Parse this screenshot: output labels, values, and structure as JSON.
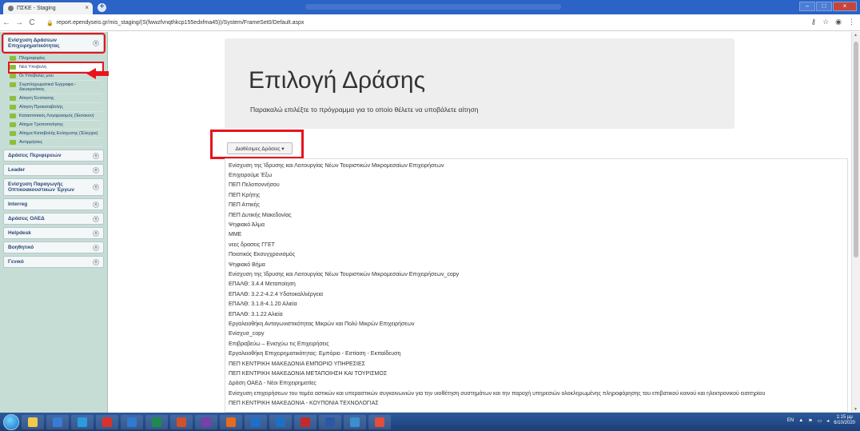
{
  "browser": {
    "tab_title": "ΠΣΚΕ - Staging",
    "tab_close": "×",
    "new_tab": "+",
    "nav": {
      "back": "←",
      "forward": "→",
      "reload": "C"
    },
    "url": "report.ependyseis.gr/mis_staging/(S(fwwzfvnqthkcp155edxfma45))/System/FrameSet0/Default.aspx",
    "window_buttons": {
      "minimize": "–",
      "maximize": "□",
      "close": "×"
    }
  },
  "sidebar": {
    "sections": [
      {
        "label": "Ενίσχυση Δράσεων Επιχειρηματικότητας",
        "expanded": true,
        "items": [
          "Πληροφορίες",
          "Νέα Υποβολή",
          "Οι Υποβολές μου",
          "Συμπληρωματικά Έγγραφα - Διευκρινίσεις",
          "Αίτηση Ένστασης",
          "Αίτηση Προκαταβολής",
          "Καταστατικός Λογαριασμός (Έκτοκον)",
          "Αίτημα Τροποποίησης",
          "Αίτημα Καταβολής Ενίσχυσης (Έλεγχοι)",
          "Αντιρρήσεις"
        ]
      },
      {
        "label": "Δράσεις Περιφερειών",
        "expanded": false
      },
      {
        "label": "Leader",
        "expanded": false
      },
      {
        "label": "Ενίσχυση Παραγωγής Οπτικοακουστικών Έργων",
        "expanded": false
      },
      {
        "label": "Interreg",
        "expanded": false
      },
      {
        "label": "Δράσεις ΟΑΕΔ",
        "expanded": false
      },
      {
        "label": "Helpdesk",
        "expanded": false
      },
      {
        "label": "Βοηθητικό",
        "expanded": false
      },
      {
        "label": "Γενικό",
        "expanded": false
      }
    ],
    "chevron": "»"
  },
  "main": {
    "title": "Επιλογή Δράσης",
    "subtitle": "Παρακαλώ επιλέξτε το πρόγραμμα για το οποίο θέλετε να υποβάλετε αίτηση",
    "dropdown_label": "Διαθέσιμες Δράσεις ▾",
    "actions": [
      "Ενίσχυση της Ίδρυσης και Λειτουργίας Νέων Τουριστικών Μικρομεσαίων Επιχειρήσεων",
      "Επιχειρούμε Έξω",
      "ΠΕΠ Πελοποννήσου",
      "ΠΕΠ Κρήτης",
      "ΠΕΠ Αττικής",
      "ΠΕΠ Δυτικής Μακεδονίας",
      "Ψηφιακό Άλμα",
      "ΜΜΕ",
      "νεες δρασεις ΓΓΕΤ",
      "Ποιοτικός Εκσυγχρονισμός",
      "Ψηφιακό Βήμα",
      "Ενίσχυση της Ίδρυσης και Λειτουργίας Νέων Τουριστικών Μικρομεσαίων Επιχειρήσεων_copy",
      "ΕΠΑΛΘ: 3.4.4 Μεταποίηση",
      "ΕΠΑΛΘ: 3.2.2-4.2.4 Υδατοκαλλιέργεια",
      "ΕΠΑΛΘ: 3.1.8-4.1.20 Αλιεία",
      "ΕΠΑΛΘ: 3.1.22 Αλιεία",
      "Εργαλειοθήκη Ανταγωνιστικότητας Μικρών και Πολύ Μικρών Επιχειρήσεων",
      "Ενίσχυσ_copy",
      "Επιβραβεύω – Ενισχύω τις Επιχειρήσεις",
      "Εργαλειοθήκη Επιχειρηματικότητας: Εμπόριο - Εστίαση - Εκπαίδευση",
      "ΠΕΠ ΚΕΝΤΡΙΚΗ ΜΑΚΕΔΟΝΙΑ ΕΜΠΟΡΙΟ ΥΠΗΡΕΣΙΕΣ",
      "ΠΕΠ ΚΕΝΤΡΙΚΗ ΜΑΚΕΔΟΝΙΑ ΜΕΤΑΠΟΙΗΣΗ ΚΑΙ ΤΟΥΡΙΣΜΟΣ",
      "Δράση ΟΑΕΔ - Νέοι Επιχειρηματίες",
      "Ενίσχυση επιχειρήσεων του τομέα αστικών και υπεραστικών συγκοινωνιών για την υιοθέτηση συστημάτων και την παροχή υπηρεσιών ολοκληρωμένης πληροφόρησης του επιβατικού κοινού και ηλεκτρονικού εισιτηρίου",
      "ΠΕΠ ΚΕΝΤΡΙΚΗ ΜΑΚΕΔΟΝΙΑ - ΚΟΥΠΟΝΙΑ ΤΕΧΝΟΛΟΓΙΑΣ"
    ]
  },
  "taskbar": {
    "apps": [
      {
        "name": "explorer",
        "color": "#f2c94c"
      },
      {
        "name": "media",
        "color": "#3a7bd5"
      },
      {
        "name": "ie",
        "color": "#2b9be0"
      },
      {
        "name": "acrobat",
        "color": "#d9322d"
      },
      {
        "name": "outlook-alt",
        "color": "#2e7bd1"
      },
      {
        "name": "excel",
        "color": "#1f8a4c"
      },
      {
        "name": "powerpoint",
        "color": "#d0512a"
      },
      {
        "name": "onenote",
        "color": "#7a3fa8"
      },
      {
        "name": "firefox",
        "color": "#e66b1e"
      },
      {
        "name": "outlook",
        "color": "#1e6fc8"
      },
      {
        "name": "outlook-2",
        "color": "#1e6fc8"
      },
      {
        "name": "acrobat-2",
        "color": "#c32b2b"
      },
      {
        "name": "word",
        "color": "#2a5aa6"
      },
      {
        "name": "pdf",
        "color": "#3a8fd0"
      },
      {
        "name": "chrome",
        "color": "#e44d3a"
      }
    ],
    "tray": {
      "lang": "EN",
      "time": "1:15 μμ",
      "date": "6/10/2020"
    }
  }
}
